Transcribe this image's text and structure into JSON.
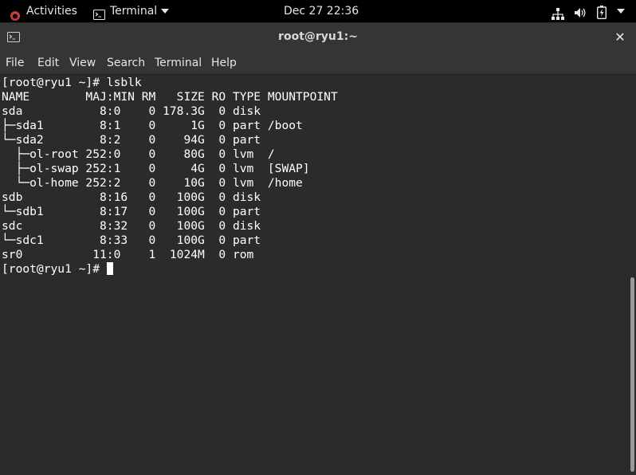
{
  "topbar": {
    "activities": "Activities",
    "app_name": "Terminal",
    "clock": "Dec 27  22:36"
  },
  "window": {
    "title": "root@ryu1:~",
    "close_glyph": "✕"
  },
  "menu": {
    "items": [
      "File",
      "Edit",
      "View",
      "Search",
      "Terminal",
      "Help"
    ]
  },
  "terminal": {
    "lines": [
      "[root@ryu1 ~]# lsblk",
      "NAME        MAJ:MIN RM   SIZE RO TYPE MOUNTPOINT",
      "sda           8:0    0 178.3G  0 disk",
      "├─sda1        8:1    0     1G  0 part /boot",
      "└─sda2        8:2    0    94G  0 part",
      "  ├─ol-root 252:0    0    80G  0 lvm  /",
      "  ├─ol-swap 252:1    0     4G  0 lvm  [SWAP]",
      "  └─ol-home 252:2    0    10G  0 lvm  /home",
      "sdb           8:16   0   100G  0 disk",
      "└─sdb1        8:17   0   100G  0 part",
      "sdc           8:32   0   100G  0 disk",
      "└─sdc1        8:33   0   100G  0 part",
      "sr0          11:0    1  1024M  0 rom"
    ],
    "prompt": "[root@ryu1 ~]# "
  },
  "icons": {
    "activities": "gnome-foot-icon",
    "app": "terminal-icon",
    "network": "network-wired-icon",
    "volume": "speaker-volume-icon",
    "battery": "battery-charging-icon",
    "system_menu": "chevron-down-icon",
    "close": "close-icon"
  },
  "colors": {
    "terminal_bg": "#2b2b2b",
    "terminal_fg": "#ffffff",
    "topbar_bg": "#000000",
    "titlebar_bg": "#353535"
  }
}
